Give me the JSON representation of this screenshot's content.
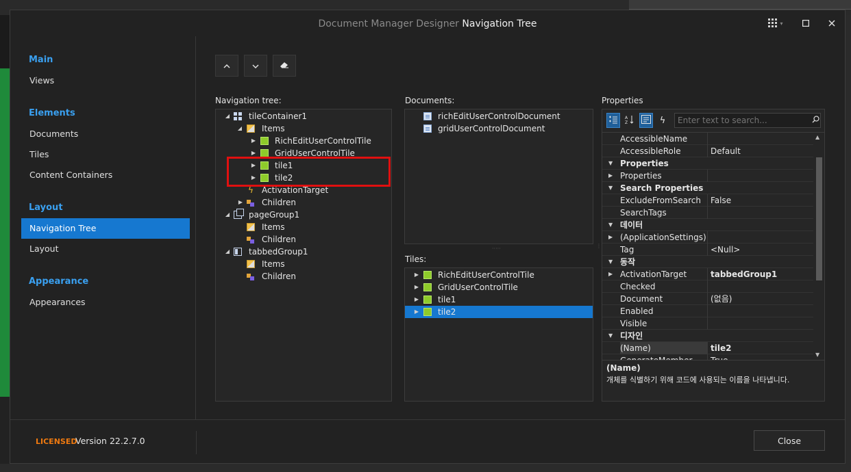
{
  "dialog": {
    "title_dim": "Document Manager Designer",
    "title_main": "Navigation Tree",
    "icons": {
      "menu": "grid-menu-icon",
      "maximize": "maximize-icon",
      "close": "close-icon"
    }
  },
  "nav": {
    "groups": [
      {
        "label": "Main",
        "items": [
          "Views"
        ]
      },
      {
        "label": "Elements",
        "items": [
          "Documents",
          "Tiles",
          "Content Containers"
        ]
      },
      {
        "label": "Layout",
        "items": [
          "Navigation Tree",
          "Layout"
        ]
      },
      {
        "label": "Appearance",
        "items": [
          "Appearances"
        ]
      }
    ],
    "selected": "Navigation Tree"
  },
  "toolbar": {
    "icons": [
      "chevron-up-icon",
      "chevron-down-icon",
      "eraser-icon"
    ]
  },
  "navtree": {
    "label": "Navigation tree:",
    "rows": [
      {
        "text": "tileContainer1",
        "icon": "container-icon"
      },
      {
        "text": "Items",
        "icon": "items-icon"
      },
      {
        "text": "RichEditUserControlTile",
        "icon": "tile-icon"
      },
      {
        "text": "GridUserControlTile",
        "icon": "tile-icon"
      },
      {
        "text": "tile1",
        "icon": "tile-icon"
      },
      {
        "text": "tile2",
        "icon": "tile-icon"
      },
      {
        "text": "ActivationTarget",
        "icon": "bolt-icon"
      },
      {
        "text": "Children",
        "icon": "children-icon"
      },
      {
        "text": "pageGroup1",
        "icon": "page-group-icon"
      },
      {
        "text": "Items",
        "icon": "items-icon"
      },
      {
        "text": "Children",
        "icon": "children-icon"
      },
      {
        "text": "tabbedGroup1",
        "icon": "tabbed-group-icon"
      },
      {
        "text": "Items",
        "icon": "items-icon"
      },
      {
        "text": "Children",
        "icon": "children-icon"
      }
    ]
  },
  "documents": {
    "label": "Documents:",
    "rows": [
      "richEditUserControlDocument",
      "gridUserControlDocument"
    ]
  },
  "tiles": {
    "label": "Tiles:",
    "rows": [
      "RichEditUserControlTile",
      "GridUserControlTile",
      "tile1",
      "tile2"
    ],
    "selected": "tile2"
  },
  "properties": {
    "label": "Properties",
    "search_placeholder": "Enter text to search...",
    "rows": [
      {
        "name": "AccessibleName",
        "value": ""
      },
      {
        "name": "AccessibleRole",
        "value": "Default"
      },
      {
        "name": "Properties",
        "category": true
      },
      {
        "name": "Properties",
        "value": ""
      },
      {
        "name": "Search Properties",
        "category": true
      },
      {
        "name": "ExcludeFromSearch",
        "value": "False"
      },
      {
        "name": "SearchTags",
        "value": ""
      },
      {
        "name": "데이터",
        "category": true
      },
      {
        "name": "(ApplicationSettings)",
        "value": ""
      },
      {
        "name": "Tag",
        "value": "<Null>"
      },
      {
        "name": "동작",
        "category": true
      },
      {
        "name": "ActivationTarget",
        "value": "tabbedGroup1",
        "bold": true
      },
      {
        "name": "Checked",
        "value": ""
      },
      {
        "name": "Document",
        "value": "(없음)"
      },
      {
        "name": "Enabled",
        "value": ""
      },
      {
        "name": "Visible",
        "value": ""
      },
      {
        "name": "디자인",
        "category": true
      },
      {
        "name": "(Name)",
        "value": "tile2",
        "bold": true
      },
      {
        "name": "GenerateMember",
        "value": "True"
      }
    ],
    "desc_title": "(Name)",
    "desc_text": "개체를 식별하기 위해 코드에 사용되는 이름을 나타냅니다."
  },
  "footer": {
    "licensed": "LICENSED",
    "version": "Version 22.2.7.0",
    "close_label": "Close"
  }
}
